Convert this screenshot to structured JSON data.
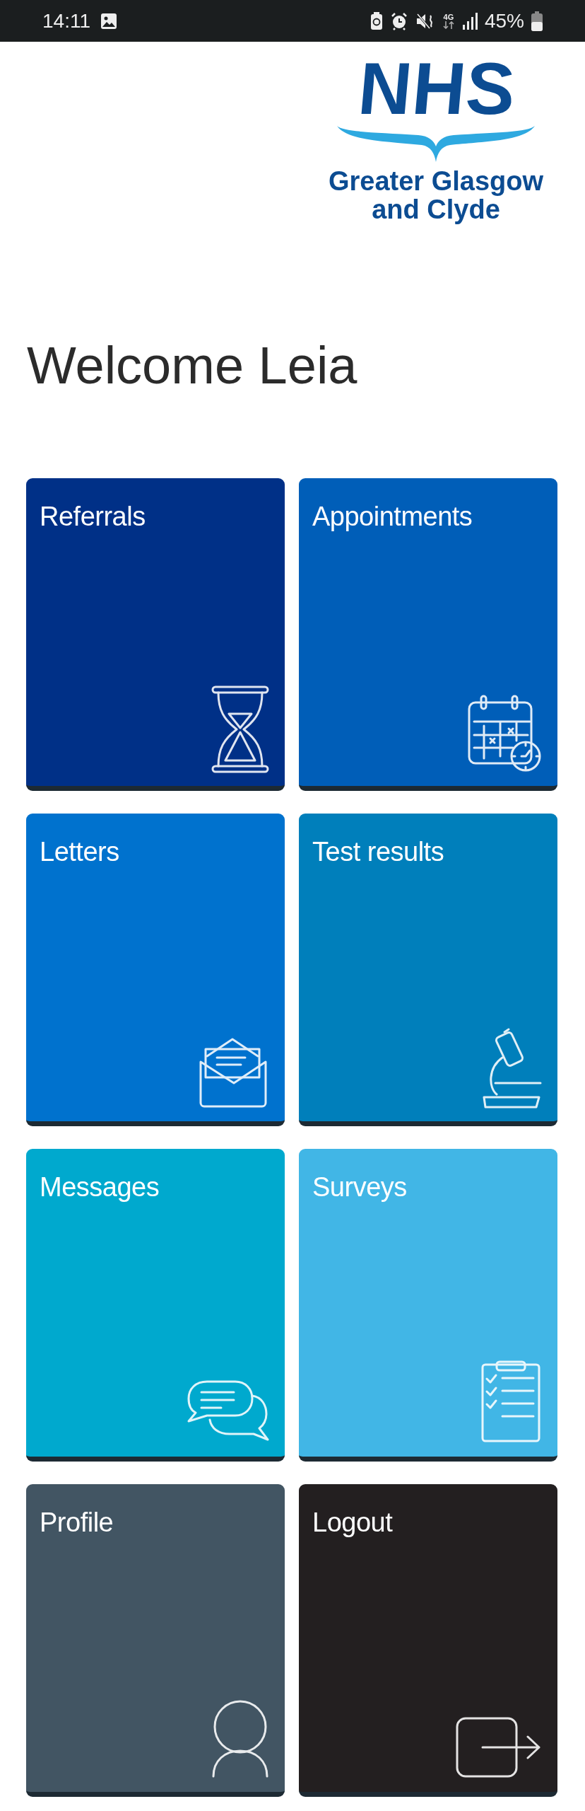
{
  "status_bar": {
    "time": "14:11",
    "network": "4G",
    "battery": "45%"
  },
  "logo": {
    "title": "NHS",
    "subtitle_lines": [
      "Greater Glasgow",
      "and Clyde"
    ]
  },
  "heading": "Welcome Leia",
  "tiles": [
    {
      "label": "Referrals",
      "color": "#003087"
    },
    {
      "label": "Appointments",
      "color": "#005eb8"
    },
    {
      "label": "Letters",
      "color": "#0072ce"
    },
    {
      "label": "Test results",
      "color": "#007fbb"
    },
    {
      "label": "Messages",
      "color": "#00a9ce"
    },
    {
      "label": "Surveys",
      "color": "#41b6e6"
    },
    {
      "label": "Profile",
      "color": "#425563"
    },
    {
      "label": "Logout",
      "color": "#231f20"
    }
  ]
}
